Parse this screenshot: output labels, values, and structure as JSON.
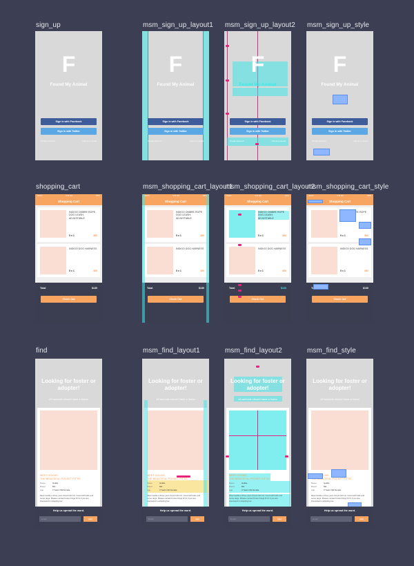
{
  "labels": {
    "r1": [
      "sign_up",
      "msm_sign_up_layout1",
      "msm_sign_up_layout2",
      "msm_sign_up_style"
    ],
    "r2": [
      "shopping_cart",
      "msm_shopping_cart_layout1",
      "msm_shopping_cart_layout2",
      "msm_shopping_cart_style"
    ],
    "r3": [
      "find",
      "msm_find_layout1",
      "msm_find_layout2",
      "msm_find_style"
    ]
  },
  "signup": {
    "logo_letter": "F",
    "brand": "Found My Animal",
    "facebook_label": "Sign in with Facebook",
    "twitter_label": "Sign in with Twitter",
    "create_account": "Create Account",
    "guest": "Use as a Guest"
  },
  "cart": {
    "status_carrier": "Sketch",
    "status_time": "9:41 AM",
    "status_battery": "100%",
    "title": "Shopping Cart",
    "items": [
      {
        "name": "INDIGO OMBRE ROPE DOG LEASH, ADJUSTABLE",
        "qty": "5 x 1",
        "price": "$80"
      },
      {
        "name": "INDIGO DOG HARNESS",
        "qty": "5 x 1",
        "price": "$50"
      }
    ],
    "total_label": "Total",
    "total_value": "$130",
    "checkout_label": "Check Out"
  },
  "find": {
    "headline": "Looking for foster or adopter!",
    "subline": "All animals should have a home",
    "title_line1": "MEET GOLDIE,",
    "title_line2": "THE BEAUTIFUL POCKET PITTIE",
    "rows": [
      {
        "k": "Name",
        "v": "Goldie"
      },
      {
        "k": "Breed",
        "v": "Mix"
      },
      {
        "k": "Age",
        "v": "3 Years Old Female"
      }
    ],
    "description": "Meet Goldie a three year old pit bull mix. Good with kids and some dogs. Please contact Foster Dogs NYC if you are interested in adopting her.",
    "call_label": "Call",
    "spread_label": "Help us spread the word.",
    "email_placeholder": "Email",
    "join_label": "Join"
  },
  "colors": {
    "background": "#3c3f53",
    "orange": "#f7a560",
    "facebook": "#3f5c9a",
    "twitter": "#5aa7e4",
    "cyan": "#40e8e8",
    "magenta": "#e8237d"
  }
}
